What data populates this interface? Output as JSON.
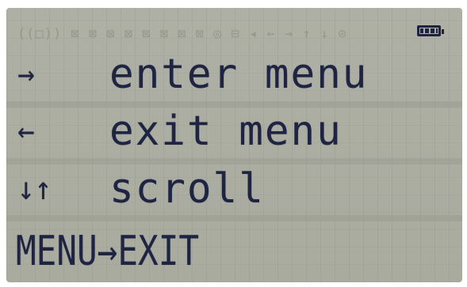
{
  "status_bar": {
    "ghost_segments": "((□)) ⊠ ⊠ ⊠ ⊠ ⊠ ⊠ ⊠ ⊠ ◎ ⊟ ◂ ← → ↑ ↓ ⊙",
    "battery_icon": "battery-full-icon"
  },
  "rows": [
    {
      "glyph": "→",
      "label": "enter menu"
    },
    {
      "glyph": "←",
      "label": "exit menu"
    },
    {
      "glyph": "↓↑",
      "label": "scroll"
    }
  ],
  "footer": {
    "text": "MENU→EXIT"
  },
  "colors": {
    "lcd_background": "#aeb0a5",
    "segment_ink": "#1e2442"
  }
}
